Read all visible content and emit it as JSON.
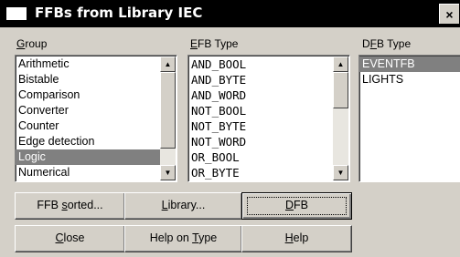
{
  "window": {
    "title": "FFBs from Library IEC",
    "close_glyph": "×"
  },
  "columns": {
    "group": {
      "label_pre": "",
      "label_u": "G",
      "label_post": "roup"
    },
    "efb_type": {
      "label_pre": "",
      "label_u": "E",
      "label_post": "FB Type"
    },
    "dfb_type": {
      "label_pre": "D",
      "label_u": "F",
      "label_post": "B Type"
    }
  },
  "group_list": [
    {
      "label": "Arithmetic",
      "selected": false
    },
    {
      "label": "Bistable",
      "selected": false
    },
    {
      "label": "Comparison",
      "selected": false
    },
    {
      "label": "Converter",
      "selected": false
    },
    {
      "label": "Counter",
      "selected": false
    },
    {
      "label": "Edge detection",
      "selected": false
    },
    {
      "label": "Logic",
      "selected": true
    },
    {
      "label": "Numerical",
      "selected": false
    }
  ],
  "efb_list": [
    {
      "label": "AND_BOOL"
    },
    {
      "label": "AND_BYTE"
    },
    {
      "label": "AND_WORD"
    },
    {
      "label": "NOT_BOOL"
    },
    {
      "label": "NOT_BYTE"
    },
    {
      "label": "NOT_WORD"
    },
    {
      "label": "OR_BOOL"
    },
    {
      "label": "OR_BYTE"
    }
  ],
  "dfb_list": [
    {
      "label": "EVENTFB",
      "selected": true
    },
    {
      "label": "LIGHTS",
      "selected": false
    }
  ],
  "scroll": {
    "up_glyph": "▲",
    "down_glyph": "▼"
  },
  "buttons": {
    "ffb_sorted": {
      "pre": "FFB ",
      "u": "s",
      "post": "orted..."
    },
    "library": {
      "pre": "",
      "u": "L",
      "post": "ibrary..."
    },
    "dfb": {
      "pre": "",
      "u": "D",
      "post": "FB"
    },
    "close": {
      "pre": "",
      "u": "C",
      "post": "lose"
    },
    "help_on_type": {
      "pre": "Help on ",
      "u": "T",
      "post": "ype"
    },
    "help": {
      "pre": "",
      "u": "H",
      "post": "elp"
    }
  }
}
